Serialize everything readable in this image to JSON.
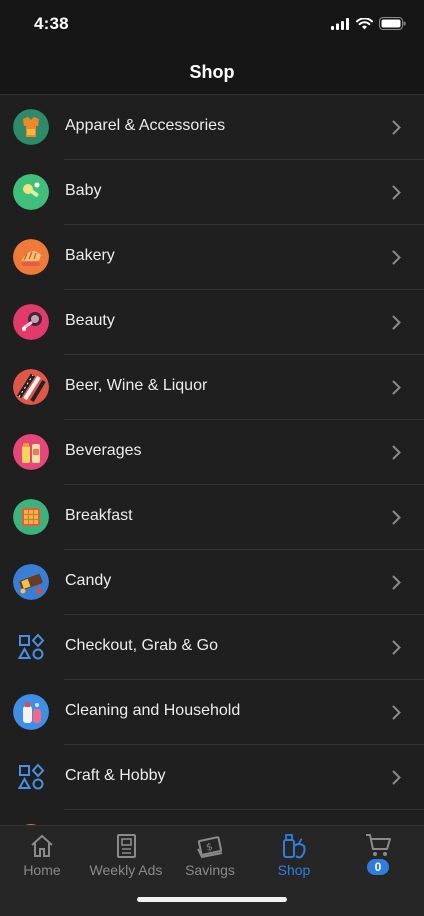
{
  "status": {
    "time": "4:38"
  },
  "header": {
    "title": "Shop"
  },
  "categories": [
    {
      "label": "Apparel & Accessories",
      "icon": "apparel-icon"
    },
    {
      "label": "Baby",
      "icon": "baby-icon"
    },
    {
      "label": "Bakery",
      "icon": "bakery-icon"
    },
    {
      "label": "Beauty",
      "icon": "beauty-icon"
    },
    {
      "label": "Beer, Wine & Liquor",
      "icon": "beer-wine-liquor-icon"
    },
    {
      "label": "Beverages",
      "icon": "beverages-icon"
    },
    {
      "label": "Breakfast",
      "icon": "breakfast-icon"
    },
    {
      "label": "Candy",
      "icon": "candy-icon"
    },
    {
      "label": "Checkout, Grab & Go",
      "icon": "shapes-icon"
    },
    {
      "label": "Cleaning and Household",
      "icon": "cleaning-icon"
    },
    {
      "label": "Craft & Hobby",
      "icon": "shapes-icon"
    }
  ],
  "tabs": {
    "home": "Home",
    "weekly_ads": "Weekly Ads",
    "savings": "Savings",
    "shop": "Shop",
    "cart_count": "0"
  },
  "colors": {
    "accent": "#2f7de1",
    "background": "#1f1f1f",
    "header": "#161616"
  }
}
